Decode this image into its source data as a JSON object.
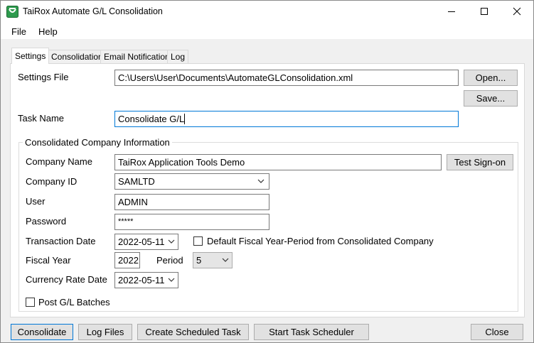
{
  "window": {
    "title": "TaiRox Automate G/L Consolidation",
    "icon": "tairox-logo-icon",
    "controls": [
      "minimize-icon",
      "maximize-icon",
      "close-icon"
    ]
  },
  "menu": {
    "file": "File",
    "help": "Help"
  },
  "tabs": [
    {
      "label": "Settings",
      "active": true
    },
    {
      "label": "Consolidation",
      "active": false
    },
    {
      "label": "Email Notification",
      "active": false
    },
    {
      "label": "Log",
      "active": false
    }
  ],
  "settings": {
    "settings_file_label": "Settings File",
    "settings_file_value": "C:\\Users\\User\\Documents\\AutomateGLConsolidation.xml",
    "open_button": "Open...",
    "save_button": "Save...",
    "task_name_label": "Task Name",
    "task_name_value": "Consolidate G/L"
  },
  "company_info": {
    "group_title": "Consolidated Company Information",
    "company_name_label": "Company Name",
    "company_name_value": "TaiRox Application Tools Demo",
    "test_signon_button": "Test Sign-on",
    "company_id_label": "Company ID",
    "company_id_value": "SAMLTD",
    "user_label": "User",
    "user_value": "ADMIN",
    "password_label": "Password",
    "password_value": "*****",
    "transaction_date_label": "Transaction Date",
    "transaction_date_value": "2022-05-11",
    "default_fiscal_label": "Default Fiscal Year-Period from Consolidated Company",
    "default_fiscal_checked": false,
    "fiscal_year_label": "Fiscal Year",
    "fiscal_year_value": "2022",
    "period_label": "Period",
    "period_value": "5",
    "currency_rate_date_label": "Currency Rate Date",
    "currency_rate_date_value": "2022-05-11",
    "post_batches_label": "Post G/L Batches",
    "post_batches_checked": false
  },
  "footer": {
    "consolidate": "Consolidate",
    "log_files": "Log Files",
    "create_task": "Create Scheduled Task",
    "start_scheduler": "Start Task Scheduler",
    "close": "Close"
  },
  "colors": {
    "focus_border": "#0078d7",
    "button_face": "#e1e1e1",
    "window_bg": "#f0f0f0",
    "logo_green": "#2e9b4e"
  }
}
